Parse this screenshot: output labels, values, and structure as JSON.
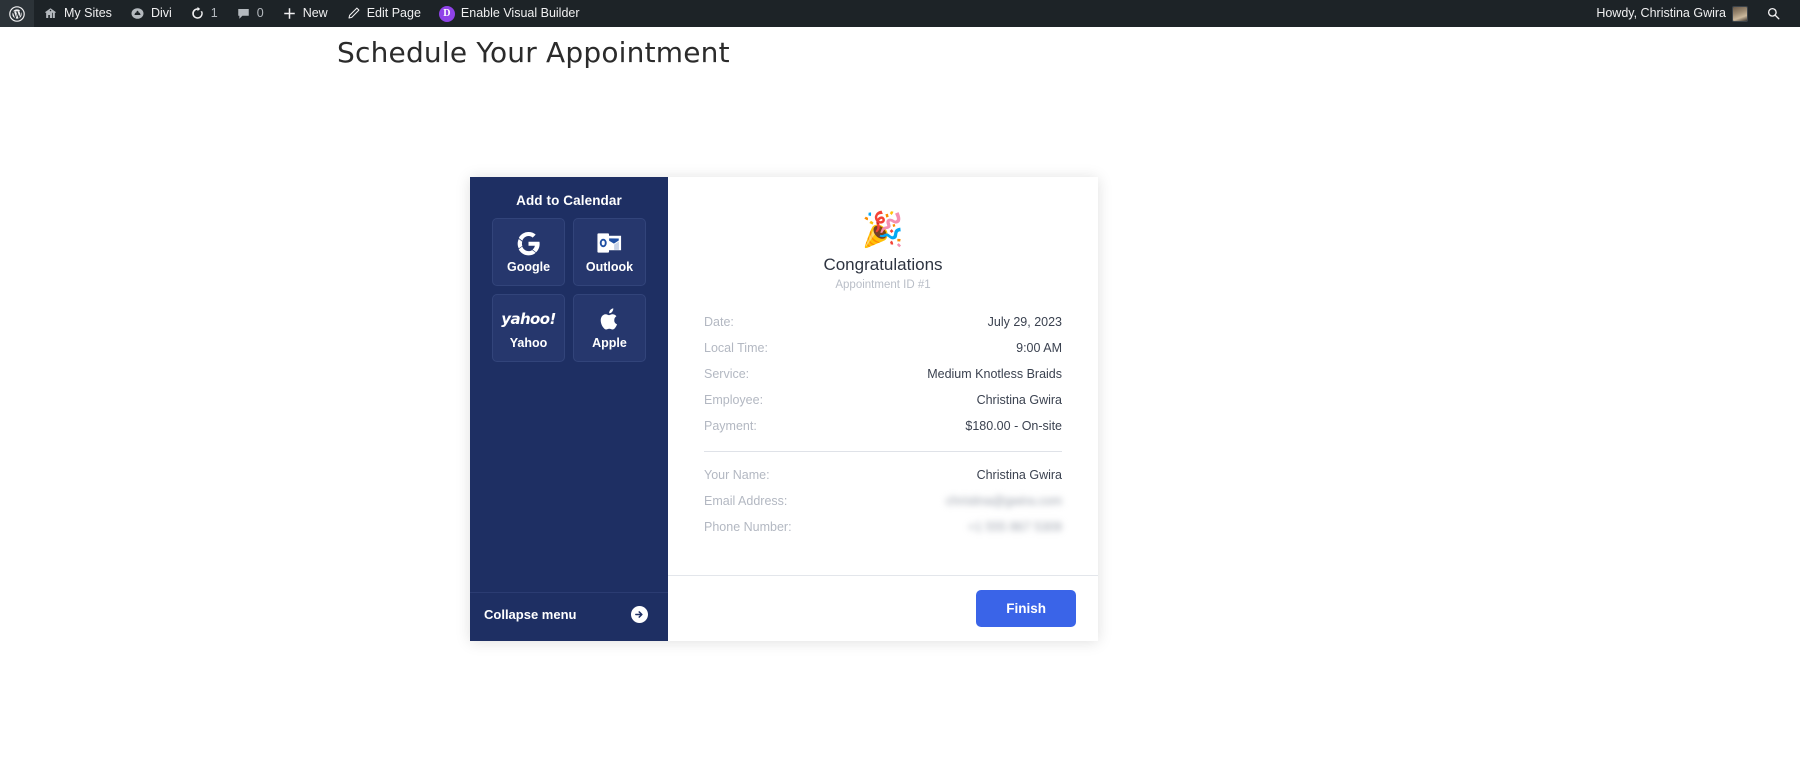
{
  "admin_bar": {
    "left_items": [
      {
        "icon": "wordpress-logo-icon",
        "label": ""
      },
      {
        "icon": "my-sites-icon",
        "label": "My Sites"
      },
      {
        "icon": "divi-icon",
        "label": "Divi"
      },
      {
        "icon": "updates-icon",
        "label": "1"
      },
      {
        "icon": "comments-icon",
        "label": "0"
      },
      {
        "icon": "plus-icon",
        "label": "New"
      },
      {
        "icon": "pencil-icon",
        "label": "Edit Page"
      },
      {
        "icon": "divi-badge-icon",
        "label": "Enable Visual Builder"
      }
    ],
    "howdy": "Howdy, Christina Gwira",
    "avatar": "user-avatar",
    "search": "search-icon",
    "divi_badge_letter": "D",
    "divi_badge_color": "#8f42e8"
  },
  "page": {
    "title": "Schedule Your Appointment"
  },
  "sidebar": {
    "heading": "Add to Calendar",
    "background_color": "#1e2f63",
    "buttons": [
      {
        "label": "Google",
        "icon": "google-icon"
      },
      {
        "label": "Outlook",
        "icon": "outlook-icon"
      },
      {
        "label": "Yahoo",
        "icon": "yahoo-icon"
      },
      {
        "label": "Apple",
        "icon": "apple-icon"
      }
    ],
    "collapse": {
      "label": "Collapse menu",
      "icon": "arrow-right-circle-icon"
    }
  },
  "confirmation": {
    "party_icon": "🎉",
    "title": "Congratulations",
    "appointment_id": "Appointment ID #1",
    "primary_details": [
      {
        "label": "Date:",
        "value": "July 29, 2023",
        "redacted": false
      },
      {
        "label": "Local Time:",
        "value": "9:00 AM",
        "redacted": false
      },
      {
        "label": "Service:",
        "value": "Medium Knotless Braids",
        "redacted": false
      },
      {
        "label": "Employee:",
        "value": "Christina Gwira",
        "redacted": false
      },
      {
        "label": "Payment:",
        "value": "$180.00 - On-site",
        "redacted": false
      }
    ],
    "customer_details": [
      {
        "label": "Your Name:",
        "value": "Christina Gwira",
        "redacted": false
      },
      {
        "label": "Email Address:",
        "value": "christina@gwira.com",
        "redacted": true
      },
      {
        "label": "Phone Number:",
        "value": "+1 555 867 5309",
        "redacted": true
      }
    ],
    "finish_label": "Finish",
    "finish_color": "#3a64e8"
  }
}
